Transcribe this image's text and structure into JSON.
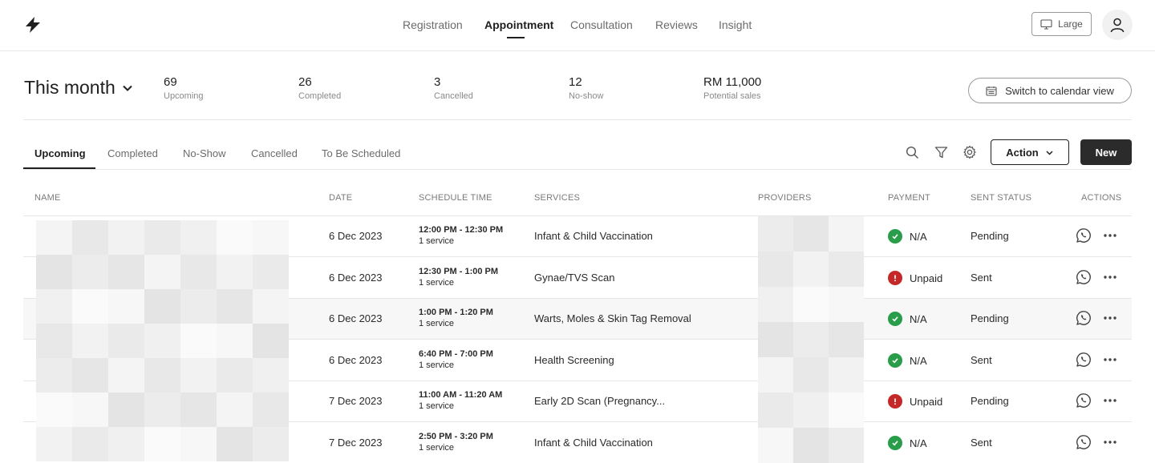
{
  "nav": {
    "items": [
      {
        "label": "Registration",
        "active": false
      },
      {
        "label": "Appointment",
        "active": true
      },
      {
        "label": "Consultation",
        "active": false
      },
      {
        "label": "Reviews",
        "active": false
      },
      {
        "label": "Insight",
        "active": false
      }
    ],
    "size_label": "Large"
  },
  "summary": {
    "period": "This month",
    "stats": [
      {
        "value": "69",
        "label": "Upcoming"
      },
      {
        "value": "26",
        "label": "Completed"
      },
      {
        "value": "3",
        "label": "Cancelled"
      },
      {
        "value": "12",
        "label": "No-show"
      },
      {
        "value": "RM 11,000",
        "label": "Potential sales"
      }
    ],
    "calendar_button": "Switch to calendar view"
  },
  "tabs": [
    {
      "label": "Upcoming",
      "active": true
    },
    {
      "label": "Completed",
      "active": false
    },
    {
      "label": "No-Show",
      "active": false
    },
    {
      "label": "Cancelled",
      "active": false
    },
    {
      "label": "To Be Scheduled",
      "active": false
    }
  ],
  "toolbar": {
    "action_label": "Action",
    "new_label": "New"
  },
  "table": {
    "headers": {
      "name": "NAME",
      "date": "DATE",
      "time": "SCHEDULE TIME",
      "services": "SERVICES",
      "providers": "PROVIDERS",
      "payment": "PAYMENT",
      "sent": "SENT STATUS",
      "actions": "ACTIONS"
    },
    "rows": [
      {
        "date": "6 Dec 2023",
        "time": "12:00 PM - 12:30 PM",
        "count": "1 service",
        "service": "Infant & Child Vaccination",
        "payment": "N/A",
        "payment_status": "ok",
        "sent": "Pending"
      },
      {
        "date": "6 Dec 2023",
        "time": "12:30 PM - 1:00 PM",
        "count": "1 service",
        "service": "Gynae/TVS Scan",
        "payment": "Unpaid",
        "payment_status": "warn",
        "sent": "Sent"
      },
      {
        "date": "6 Dec 2023",
        "time": "1:00 PM - 1:20 PM",
        "count": "1 service",
        "service": "Warts, Moles & Skin Tag Removal",
        "payment": "N/A",
        "payment_status": "ok",
        "sent": "Pending"
      },
      {
        "date": "6 Dec 2023",
        "time": "6:40 PM - 7:00 PM",
        "count": "1 service",
        "service": "Health Screening",
        "payment": "N/A",
        "payment_status": "ok",
        "sent": "Sent"
      },
      {
        "date": "7 Dec 2023",
        "time": "11:00 AM - 11:20 AM",
        "count": "1 service",
        "service": "Early 2D Scan (Pregnancy...",
        "payment": "Unpaid",
        "payment_status": "warn",
        "sent": "Pending"
      },
      {
        "date": "7 Dec 2023",
        "time": "2:50 PM - 3:20 PM",
        "count": "1 service",
        "service": "Infant & Child Vaccination",
        "payment": "N/A",
        "payment_status": "ok",
        "sent": "Sent"
      }
    ]
  },
  "colors": {
    "ok": "#2a9d4a",
    "warn": "#c62828",
    "accent": "#1f1f1f"
  }
}
